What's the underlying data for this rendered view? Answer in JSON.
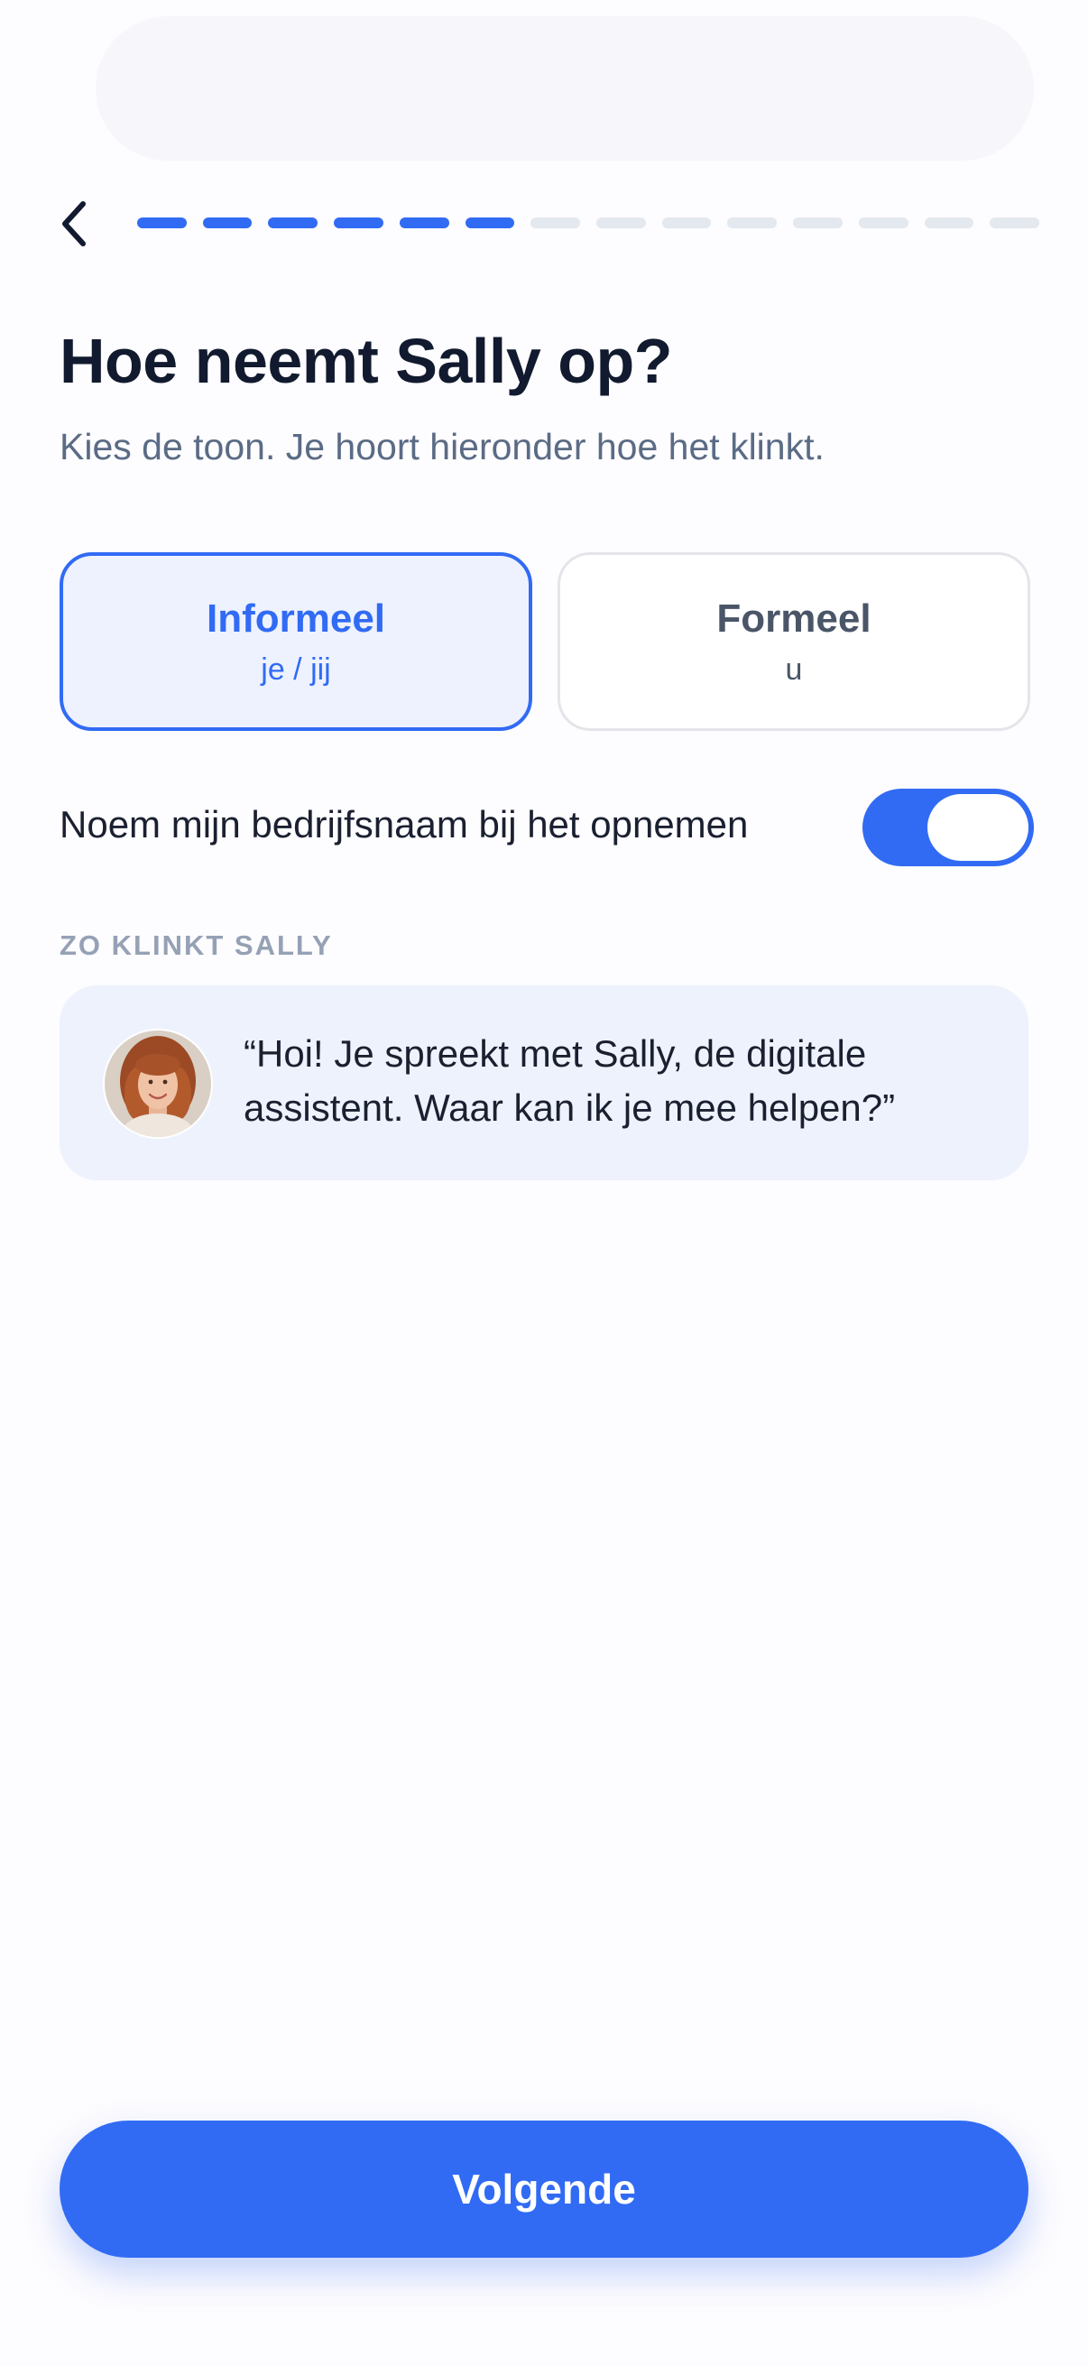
{
  "header": {
    "back_icon": "chevron-left-icon",
    "progress": {
      "completed_steps": 6,
      "total_steps": 14
    }
  },
  "main": {
    "title": "Hoe neemt Sally op?",
    "subtitle": "Kies de toon. Je hoort hieronder hoe het klinkt.",
    "options": [
      {
        "label": "Informeel",
        "sublabel": "je / jij",
        "selected": true
      },
      {
        "label": "Formeel",
        "sublabel": "u",
        "selected": false
      }
    ],
    "toggle": {
      "label": "Noem mijn bedrijfsnaam bij het opnemen",
      "on": true
    },
    "preview": {
      "section_label": "ZO KLINKT SALLY",
      "avatar_icon": "avatar",
      "quote": "“Hoi! Je spreekt met Sally, de digitale assistent. Waar kan ik je mee helpen?”"
    }
  },
  "footer": {
    "next_label": "Volgende"
  },
  "colors": {
    "accent": "#316bf4",
    "selected_bg": "#eef2fe",
    "preview_bg": "#eef2fd",
    "inactive_progress": "#e4e8ef",
    "heading": "#111a2e",
    "muted": "#5a6b85"
  }
}
